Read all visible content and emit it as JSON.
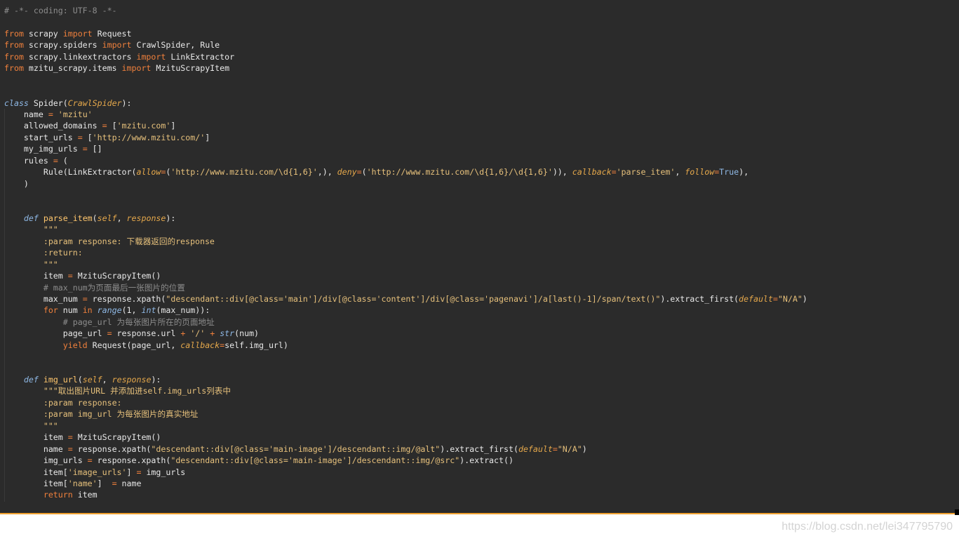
{
  "code": {
    "lines": [
      [
        {
          "t": "cm",
          "v": "# -*- coding: UTF-8 -*-"
        }
      ],
      [],
      [
        {
          "t": "kw",
          "v": "from"
        },
        {
          "t": "",
          "v": " scrapy "
        },
        {
          "t": "kw",
          "v": "import"
        },
        {
          "t": "",
          "v": " Request"
        }
      ],
      [
        {
          "t": "kw",
          "v": "from"
        },
        {
          "t": "",
          "v": " scrapy.spiders "
        },
        {
          "t": "kw",
          "v": "import"
        },
        {
          "t": "",
          "v": " CrawlSpider, Rule"
        }
      ],
      [
        {
          "t": "kw",
          "v": "from"
        },
        {
          "t": "",
          "v": " scrapy.linkextractors "
        },
        {
          "t": "kw",
          "v": "import"
        },
        {
          "t": "",
          "v": " LinkExtractor"
        }
      ],
      [
        {
          "t": "kw",
          "v": "from"
        },
        {
          "t": "",
          "v": " mzitu_scrapy.items "
        },
        {
          "t": "kw",
          "v": "import"
        },
        {
          "t": "",
          "v": " MzituScrapyItem"
        }
      ],
      [],
      [],
      [
        {
          "t": "df",
          "v": "class"
        },
        {
          "t": "",
          "v": " Spider("
        },
        {
          "t": "it",
          "v": "CrawlSpider"
        },
        {
          "t": "",
          "v": "):"
        }
      ],
      [
        {
          "t": "",
          "v": "    name "
        },
        {
          "t": "ob",
          "v": "="
        },
        {
          "t": "",
          "v": " "
        },
        {
          "t": "st",
          "v": "'mzitu'"
        }
      ],
      [
        {
          "t": "",
          "v": "    allowed_domains "
        },
        {
          "t": "ob",
          "v": "="
        },
        {
          "t": "",
          "v": " ["
        },
        {
          "t": "st",
          "v": "'mzitu.com'"
        },
        {
          "t": "",
          "v": "]"
        }
      ],
      [
        {
          "t": "",
          "v": "    start_urls "
        },
        {
          "t": "ob",
          "v": "="
        },
        {
          "t": "",
          "v": " ["
        },
        {
          "t": "st",
          "v": "'http://www.mzitu.com/'"
        },
        {
          "t": "",
          "v": "]"
        }
      ],
      [
        {
          "t": "",
          "v": "    my_img_urls "
        },
        {
          "t": "ob",
          "v": "="
        },
        {
          "t": "",
          "v": " []"
        }
      ],
      [
        {
          "t": "",
          "v": "    rules "
        },
        {
          "t": "ob",
          "v": "="
        },
        {
          "t": "",
          "v": " ("
        }
      ],
      [
        {
          "t": "",
          "v": "        Rule(LinkExtractor("
        },
        {
          "t": "kwarg",
          "v": "allow"
        },
        {
          "t": "ob",
          "v": "="
        },
        {
          "t": "",
          "v": "("
        },
        {
          "t": "st",
          "v": "'http://www.mzitu.com/\\d{1,6}'"
        },
        {
          "t": "",
          "v": ",), "
        },
        {
          "t": "kwarg",
          "v": "deny"
        },
        {
          "t": "ob",
          "v": "="
        },
        {
          "t": "",
          "v": "("
        },
        {
          "t": "st",
          "v": "'http://www.mzitu.com/\\d{1,6}/\\d{1,6}'"
        },
        {
          "t": "",
          "v": ")), "
        },
        {
          "t": "kwarg",
          "v": "callback"
        },
        {
          "t": "ob",
          "v": "="
        },
        {
          "t": "st",
          "v": "'parse_item'"
        },
        {
          "t": "",
          "v": ", "
        },
        {
          "t": "kwarg",
          "v": "follow"
        },
        {
          "t": "ob",
          "v": "="
        },
        {
          "t": "tr",
          "v": "True"
        },
        {
          "t": "",
          "v": "),"
        }
      ],
      [
        {
          "t": "",
          "v": "    )"
        }
      ],
      [],
      [],
      [
        {
          "t": "",
          "v": "    "
        },
        {
          "t": "df",
          "v": "def"
        },
        {
          "t": "",
          "v": " "
        },
        {
          "t": "fn",
          "v": "parse_item"
        },
        {
          "t": "",
          "v": "("
        },
        {
          "t": "it",
          "v": "self"
        },
        {
          "t": "",
          "v": ", "
        },
        {
          "t": "it",
          "v": "response"
        },
        {
          "t": "",
          "v": "):"
        }
      ],
      [
        {
          "t": "",
          "v": "        "
        },
        {
          "t": "st",
          "v": "\"\"\""
        }
      ],
      [
        {
          "t": "",
          "v": "        "
        },
        {
          "t": "st",
          "v": ":param response: 下载器返回的response"
        }
      ],
      [
        {
          "t": "",
          "v": "        "
        },
        {
          "t": "st",
          "v": ":return:"
        }
      ],
      [
        {
          "t": "",
          "v": "        "
        },
        {
          "t": "st",
          "v": "\"\"\""
        }
      ],
      [
        {
          "t": "",
          "v": "        item "
        },
        {
          "t": "ob",
          "v": "="
        },
        {
          "t": "",
          "v": " MzituScrapyItem()"
        }
      ],
      [
        {
          "t": "",
          "v": "        "
        },
        {
          "t": "cm",
          "v": "# max_num为页面最后一张图片的位置"
        }
      ],
      [
        {
          "t": "",
          "v": "        max_num "
        },
        {
          "t": "ob",
          "v": "="
        },
        {
          "t": "",
          "v": " response.xpath("
        },
        {
          "t": "st",
          "v": "\"descendant::div[@class='main']/div[@class='content']/div[@class='pagenavi']/a[last()-1]/span/text()\""
        },
        {
          "t": "",
          "v": ").extract_first("
        },
        {
          "t": "kwarg",
          "v": "default"
        },
        {
          "t": "ob",
          "v": "="
        },
        {
          "t": "st",
          "v": "\"N/A\""
        },
        {
          "t": "",
          "v": ")"
        }
      ],
      [
        {
          "t": "",
          "v": "        "
        },
        {
          "t": "kw",
          "v": "for"
        },
        {
          "t": "",
          "v": " num "
        },
        {
          "t": "kw",
          "v": "in"
        },
        {
          "t": "",
          "v": " "
        },
        {
          "t": "bi",
          "v": "range"
        },
        {
          "t": "",
          "v": "(1, "
        },
        {
          "t": "bi",
          "v": "int"
        },
        {
          "t": "",
          "v": "(max_num)):"
        }
      ],
      [
        {
          "t": "",
          "v": "            "
        },
        {
          "t": "cm",
          "v": "# page_url 为每张图片所在的页面地址"
        }
      ],
      [
        {
          "t": "",
          "v": "            page_url "
        },
        {
          "t": "ob",
          "v": "="
        },
        {
          "t": "",
          "v": " response.url "
        },
        {
          "t": "ob",
          "v": "+"
        },
        {
          "t": "",
          "v": " "
        },
        {
          "t": "st",
          "v": "'/'"
        },
        {
          "t": "",
          "v": " "
        },
        {
          "t": "ob",
          "v": "+"
        },
        {
          "t": "",
          "v": " "
        },
        {
          "t": "bi",
          "v": "str"
        },
        {
          "t": "",
          "v": "(num)"
        }
      ],
      [
        {
          "t": "",
          "v": "            "
        },
        {
          "t": "kw",
          "v": "yield"
        },
        {
          "t": "",
          "v": " Request(page_url, "
        },
        {
          "t": "kwarg",
          "v": "callback"
        },
        {
          "t": "ob",
          "v": "="
        },
        {
          "t": "",
          "v": "self.img_url)"
        }
      ],
      [],
      [],
      [
        {
          "t": "",
          "v": "    "
        },
        {
          "t": "df",
          "v": "def"
        },
        {
          "t": "",
          "v": " "
        },
        {
          "t": "fn",
          "v": "img_url"
        },
        {
          "t": "",
          "v": "("
        },
        {
          "t": "it",
          "v": "self"
        },
        {
          "t": "",
          "v": ", "
        },
        {
          "t": "it",
          "v": "response"
        },
        {
          "t": "",
          "v": "):"
        }
      ],
      [
        {
          "t": "",
          "v": "        "
        },
        {
          "t": "st",
          "v": "\"\"\"取出图片URL 并添加进self.img_urls列表中"
        }
      ],
      [
        {
          "t": "",
          "v": "        "
        },
        {
          "t": "st",
          "v": ":param response:"
        }
      ],
      [
        {
          "t": "",
          "v": "        "
        },
        {
          "t": "st",
          "v": ":param img_url 为每张图片的真实地址"
        }
      ],
      [
        {
          "t": "",
          "v": "        "
        },
        {
          "t": "st",
          "v": "\"\"\""
        }
      ],
      [
        {
          "t": "",
          "v": "        item "
        },
        {
          "t": "ob",
          "v": "="
        },
        {
          "t": "",
          "v": " MzituScrapyItem()"
        }
      ],
      [
        {
          "t": "",
          "v": "        name "
        },
        {
          "t": "ob",
          "v": "="
        },
        {
          "t": "",
          "v": " response.xpath("
        },
        {
          "t": "st",
          "v": "\"descendant::div[@class='main-image']/descendant::img/@alt\""
        },
        {
          "t": "",
          "v": ").extract_first("
        },
        {
          "t": "kwarg",
          "v": "default"
        },
        {
          "t": "ob",
          "v": "="
        },
        {
          "t": "st",
          "v": "\"N/A\""
        },
        {
          "t": "",
          "v": ")"
        }
      ],
      [
        {
          "t": "",
          "v": "        img_urls "
        },
        {
          "t": "ob",
          "v": "="
        },
        {
          "t": "",
          "v": " response.xpath("
        },
        {
          "t": "st",
          "v": "\"descendant::div[@class='main-image']/descendant::img/@src\""
        },
        {
          "t": "",
          "v": ").extract()"
        }
      ],
      [
        {
          "t": "",
          "v": "        item["
        },
        {
          "t": "st",
          "v": "'image_urls'"
        },
        {
          "t": "",
          "v": "] "
        },
        {
          "t": "ob",
          "v": "="
        },
        {
          "t": "",
          "v": " img_urls"
        }
      ],
      [
        {
          "t": "",
          "v": "        item["
        },
        {
          "t": "st",
          "v": "'name'"
        },
        {
          "t": "",
          "v": "]  "
        },
        {
          "t": "ob",
          "v": "="
        },
        {
          "t": "",
          "v": " name"
        }
      ],
      [
        {
          "t": "",
          "v": "        "
        },
        {
          "t": "kw",
          "v": "return"
        },
        {
          "t": "",
          "v": " item"
        }
      ]
    ]
  },
  "watermark": "https://blog.csdn.net/lei347795790",
  "colors": {
    "editor_background": "#2b2b2b",
    "keyword": "#f0803c",
    "comment": "#8c8c8c",
    "string": "#e6c07b",
    "function_name": "#ffc66d",
    "bottom_accent": "#f0a030"
  }
}
